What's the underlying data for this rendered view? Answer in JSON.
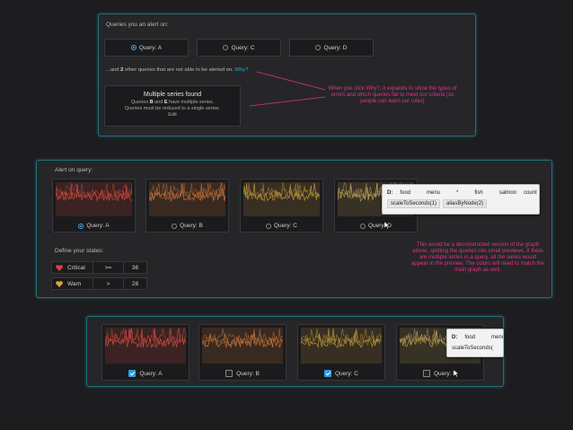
{
  "panel1": {
    "title": "Queries you an alert on:",
    "queries": [
      {
        "label": "Query: A",
        "selected": true
      },
      {
        "label": "Query: C",
        "selected": false
      },
      {
        "label": "Query: D",
        "selected": false
      }
    ],
    "note_prefix": "...and",
    "note_count": "2",
    "note_suffix": "other queries that are not able to be alerted on.",
    "note_link": "Why?",
    "error_box": {
      "title": "Multiple series found",
      "line1_pre": "Queries",
      "line1_b": "B",
      "line1_mid": "and",
      "line1_e": "E",
      "line1_post": "have multiple series.",
      "line2": "Queries must be reduced to a single series.",
      "edit": "Edit"
    }
  },
  "annotations": {
    "why": "When you click Why?, it expands to show the types of errors and which queries fail to meet our criteria (so people can learn our rules)",
    "deconstructed": "This would be a deconstructed version of the graph above, splitting the queries into small previews. If there are multiple series in a query, all the series would appear in the preview. The colors will need to match the main graph as well."
  },
  "panel2": {
    "title": "Alert on query:",
    "cards": [
      {
        "label": "Query: A",
        "selected": true,
        "color": "#c9483b"
      },
      {
        "label": "Query: B",
        "selected": false,
        "color": "#c2713a"
      },
      {
        "label": "Query: C",
        "selected": false,
        "color": "#b9913c"
      },
      {
        "label": "Query: D",
        "selected": false,
        "color": "#b89a52"
      }
    ],
    "states_title": "Define your states:",
    "states": [
      {
        "name": "Critical",
        "op": ">=",
        "value": "36",
        "color": "#d9433a"
      },
      {
        "name": "Warn",
        "op": ">",
        "value": "28",
        "color": "#d9a53a"
      }
    ],
    "tooltip": {
      "letter": "D:",
      "words": [
        "food",
        "menu",
        "*",
        "fish",
        "salmon",
        "count"
      ],
      "functions": [
        "scaleToSeconds(1)",
        "aliasByNode(2)"
      ]
    }
  },
  "panel3": {
    "cards": [
      {
        "label": "Query: A",
        "checked": true,
        "color": "#c9483b"
      },
      {
        "label": "Query: B",
        "checked": false,
        "color": "#c2713a"
      },
      {
        "label": "Query: C",
        "checked": true,
        "color": "#b9913c"
      },
      {
        "label": "Query: D",
        "checked": false,
        "color": "#b89a52"
      }
    ],
    "tooltip": {
      "letter": "D:",
      "words": [
        "food",
        "menu"
      ],
      "functions": [
        "scaleToSeconds("
      ]
    }
  }
}
